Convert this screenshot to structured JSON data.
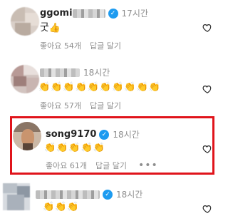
{
  "comments": [
    {
      "username": "ggomi",
      "verified": true,
      "time": "17시간",
      "text": "굿",
      "emoji": "👍",
      "likes": "좋아요 54개",
      "reply": "답글 달기"
    },
    {
      "username": "",
      "verified": false,
      "time": "18시간",
      "claps": "👏👏👏👏👏👏👏👏👏👏",
      "likes": "좋아요 57개",
      "reply": "답글 달기"
    },
    {
      "username": "song9170",
      "verified": true,
      "time": "18시간",
      "claps": "👏👏👏👏👏",
      "likes": "좋아요 61개",
      "reply": "답글 달기",
      "more": "•••"
    },
    {
      "username": "",
      "verified": true,
      "time": "18시간",
      "claps": "👏👏👏"
    }
  ],
  "icons": {
    "heart": "heart-outline-icon",
    "verified": "verified-badge-icon"
  },
  "colors": {
    "highlight": "#e0141b",
    "verified": "#1d9bf0",
    "muted": "#8e8e8e"
  }
}
